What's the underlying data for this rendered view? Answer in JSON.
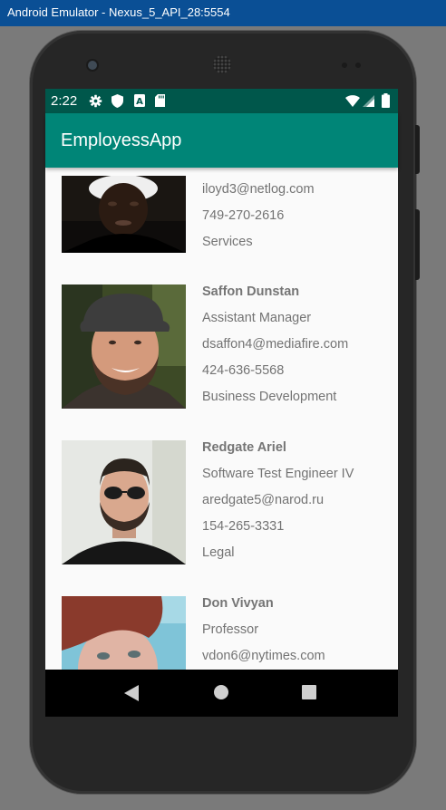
{
  "window": {
    "title": "Android Emulator - Nexus_5_API_28:5554"
  },
  "status_bar": {
    "time": "2:22",
    "left_icons": [
      "gear-icon",
      "shield-icon",
      "a-badge-icon",
      "sd-card-icon"
    ],
    "right_icons": [
      "wifi-icon",
      "signal-icon",
      "battery-icon"
    ]
  },
  "app_bar": {
    "title": "EmployessApp"
  },
  "colors": {
    "status_bar": "#00574b",
    "app_bar": "#008577",
    "list_background": "#fafafa",
    "text": "#737373"
  },
  "employees": [
    {
      "name": "",
      "title": "",
      "email": "iloyd3@netlog.com",
      "phone": "749-270-2616",
      "department": "Services"
    },
    {
      "name": "Saffon Dunstan",
      "title": "Assistant Manager",
      "email": "dsaffon4@mediafire.com",
      "phone": "424-636-5568",
      "department": "Business Development"
    },
    {
      "name": "Redgate Ariel",
      "title": "Software Test Engineer IV",
      "email": "aredgate5@narod.ru",
      "phone": "154-265-3331",
      "department": "Legal"
    },
    {
      "name": "Don Vivyan",
      "title": "Professor",
      "email": "vdon6@nytimes.com",
      "phone": "",
      "department": ""
    }
  ],
  "nav_bar": {
    "buttons": [
      "back-icon",
      "home-icon",
      "recents-icon"
    ]
  }
}
